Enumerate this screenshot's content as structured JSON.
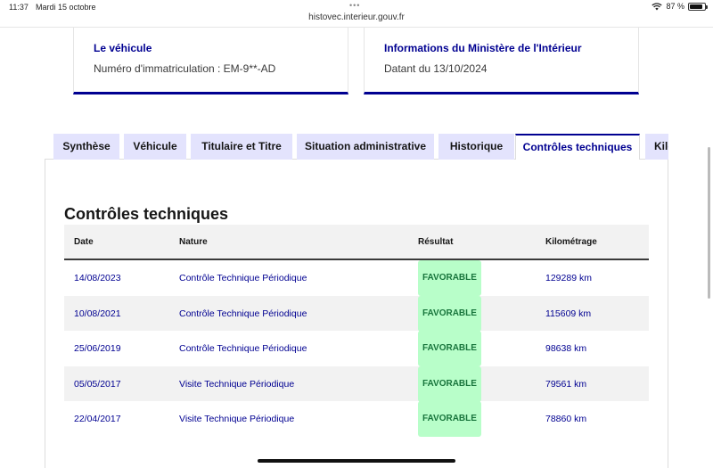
{
  "status": {
    "time": "11:37",
    "date": "Mardi 15 octobre",
    "battery": "87 %",
    "battery_level": 0.87,
    "url": "histovec.interieur.gouv.fr"
  },
  "cards": {
    "vehicle": {
      "title": "Le véhicule",
      "text": "Numéro d'immatriculation : EM-9**-AD"
    },
    "ministry": {
      "title": "Informations du Ministère de l'Intérieur",
      "text": "Datant du 13/10/2024"
    }
  },
  "tabs": [
    {
      "label": "Synthèse",
      "active": false
    },
    {
      "label": "Véhicule",
      "active": false
    },
    {
      "label": "Titulaire et Titre",
      "active": false
    },
    {
      "label": "Situation administrative",
      "active": false
    },
    {
      "label": "Historique",
      "active": false
    },
    {
      "label": "Contrôles techniques",
      "active": true
    },
    {
      "label": "Kilo",
      "active": false
    }
  ],
  "section_title": "Contrôles techniques",
  "table": {
    "headers": [
      "Date",
      "Nature",
      "Résultat",
      "Kilométrage"
    ],
    "rows": [
      {
        "date": "14/08/2023",
        "nature": "Contrôle Technique Périodique",
        "result": "FAVORABLE",
        "km": "129289 km"
      },
      {
        "date": "10/08/2021",
        "nature": "Contrôle Technique Périodique",
        "result": "FAVORABLE",
        "km": "115609 km"
      },
      {
        "date": "25/06/2019",
        "nature": "Contrôle Technique Périodique",
        "result": "FAVORABLE",
        "km": "98638 km"
      },
      {
        "date": "05/05/2017",
        "nature": "Visite Technique Périodique",
        "result": "FAVORABLE",
        "km": "79561 km"
      },
      {
        "date": "22/04/2017",
        "nature": "Visite Technique Périodique",
        "result": "FAVORABLE",
        "km": "78860 km"
      }
    ]
  },
  "colors": {
    "accent": "#000091",
    "tab_bg": "#e3e3fd",
    "badge_bg": "#b8fec9",
    "badge_text": "#18753c"
  }
}
